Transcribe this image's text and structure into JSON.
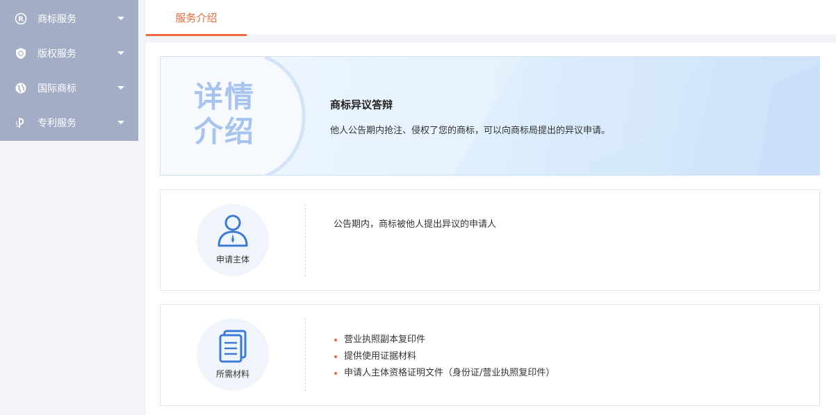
{
  "sidebar": {
    "items": [
      {
        "label": "商标服务",
        "icon": "registered-icon"
      },
      {
        "label": "版权服务",
        "icon": "copyright-shield-icon"
      },
      {
        "label": "国际商标",
        "icon": "globe-icon"
      },
      {
        "label": "专利服务",
        "icon": "patent-icon"
      }
    ]
  },
  "tabs": [
    {
      "label": "服务介绍"
    }
  ],
  "banner": {
    "badge_line1": "详情",
    "badge_line2": "介绍",
    "title": "商标异议答辩",
    "description": "他人公告期内抢注、侵权了您的商标，可以向商标局提出的异议申请。"
  },
  "applicant": {
    "label": "申请主体",
    "icon": "person-icon",
    "text": "公告期内，商标被他人提出异议的申请人"
  },
  "materials": {
    "label": "所需材料",
    "icon": "document-icon",
    "items": [
      "营业执照副本复印件",
      "提供使用证据材料",
      "申请人主体资格证明文件（身份证/营业执照复印件）"
    ]
  },
  "colors": {
    "accent": "#ec6a3c",
    "sidebar_bg": "#a3adc5",
    "icon_blue": "#3d7ad8"
  }
}
